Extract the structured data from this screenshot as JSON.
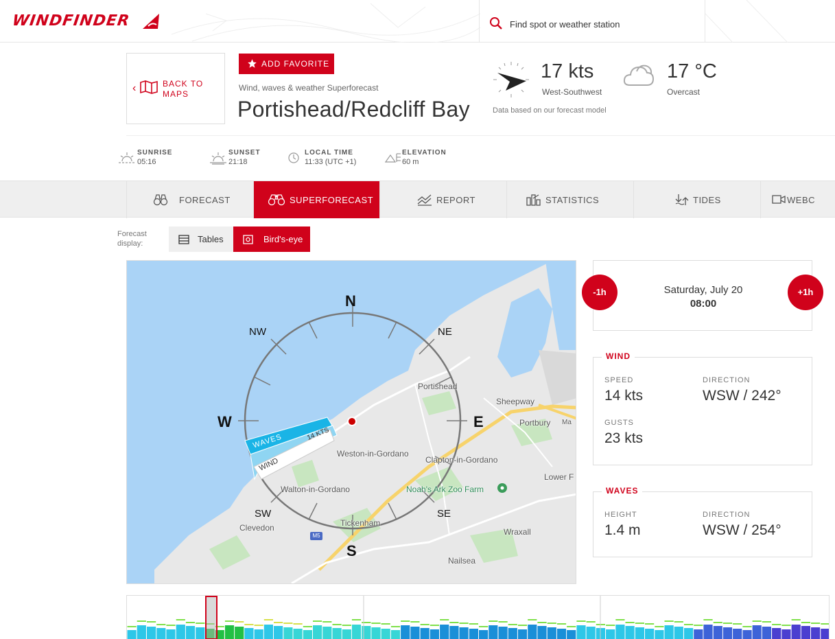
{
  "header": {
    "logo_text": "WINDFINDER",
    "search_placeholder": "Find spot or weather station"
  },
  "spot": {
    "back_label_line1": "BACK TO",
    "back_label_line2": "MAPS",
    "favorite_label": "ADD FAVORITE",
    "subtitle": "Wind, waves & weather Superforecast",
    "name": "Portishead/Redcliff Bay"
  },
  "current": {
    "wind_speed": "17 kts",
    "wind_direction": "West-Southwest",
    "temperature": "17 °C",
    "condition": "Overcast",
    "model_note": "Data based on our forecast model"
  },
  "info": {
    "sunrise_label": "SUNRISE",
    "sunrise_value": "05:16",
    "sunset_label": "SUNSET",
    "sunset_value": "21:18",
    "localtime_label": "LOCAL TIME",
    "localtime_value": "11:33 (UTC +1)",
    "elevation_label": "ELEVATION",
    "elevation_value": "60 m"
  },
  "nav": {
    "tabs": [
      {
        "label": "FORECAST",
        "active": false
      },
      {
        "label": "SUPERFORECAST",
        "active": true
      },
      {
        "label": "REPORT",
        "active": false
      },
      {
        "label": "STATISTICS",
        "active": false
      },
      {
        "label": "TIDES",
        "active": false
      },
      {
        "label": "WEBC",
        "active": false
      }
    ]
  },
  "display": {
    "label_line1": "Forecast",
    "label_line2": "display:",
    "tables_label": "Tables",
    "birdseye_label": "Bird's-eye"
  },
  "map": {
    "cardinals": {
      "n": "N",
      "s": "S",
      "e": "E",
      "w": "W",
      "ne": "NE",
      "nw": "NW",
      "se": "SE",
      "sw": "SW"
    },
    "wave_label": "WAVES",
    "wind_label": "WIND",
    "speed_label": "14 KTS",
    "places": {
      "portishead": "Portishead",
      "sheepway": "Sheepway",
      "portbury": "Portbury",
      "ma": "Ma",
      "weston": "Weston-in-Gordano",
      "clapton": "Clapton-in-Gordano",
      "lower": "Lower F",
      "walton": "Walton-in-Gordano",
      "noahs": "Noah's Ark Zoo Farm",
      "clevedon": "Clevedon",
      "tickenham": "Tickenham",
      "wraxall": "Wraxall",
      "nailsea": "Nailsea",
      "m5": "M5"
    }
  },
  "time": {
    "prev_label": "-1h",
    "next_label": "+1h",
    "date": "Saturday, July 20",
    "hour": "08:00"
  },
  "wind_panel": {
    "title": "WIND",
    "speed_label": "SPEED",
    "speed_value": "14 kts",
    "direction_label": "DIRECTION",
    "direction_value": "WSW / 242°",
    "gusts_label": "GUSTS",
    "gusts_value": "23 kts"
  },
  "waves_panel": {
    "title": "WAVES",
    "height_label": "HEIGHT",
    "height_value": "1.4 m",
    "direction_label": "DIRECTION",
    "direction_value": "WSW / 254°"
  },
  "colors": {
    "brand_red": "#d0021b",
    "water": "#aad3f6",
    "land": "#e8e8e8"
  }
}
